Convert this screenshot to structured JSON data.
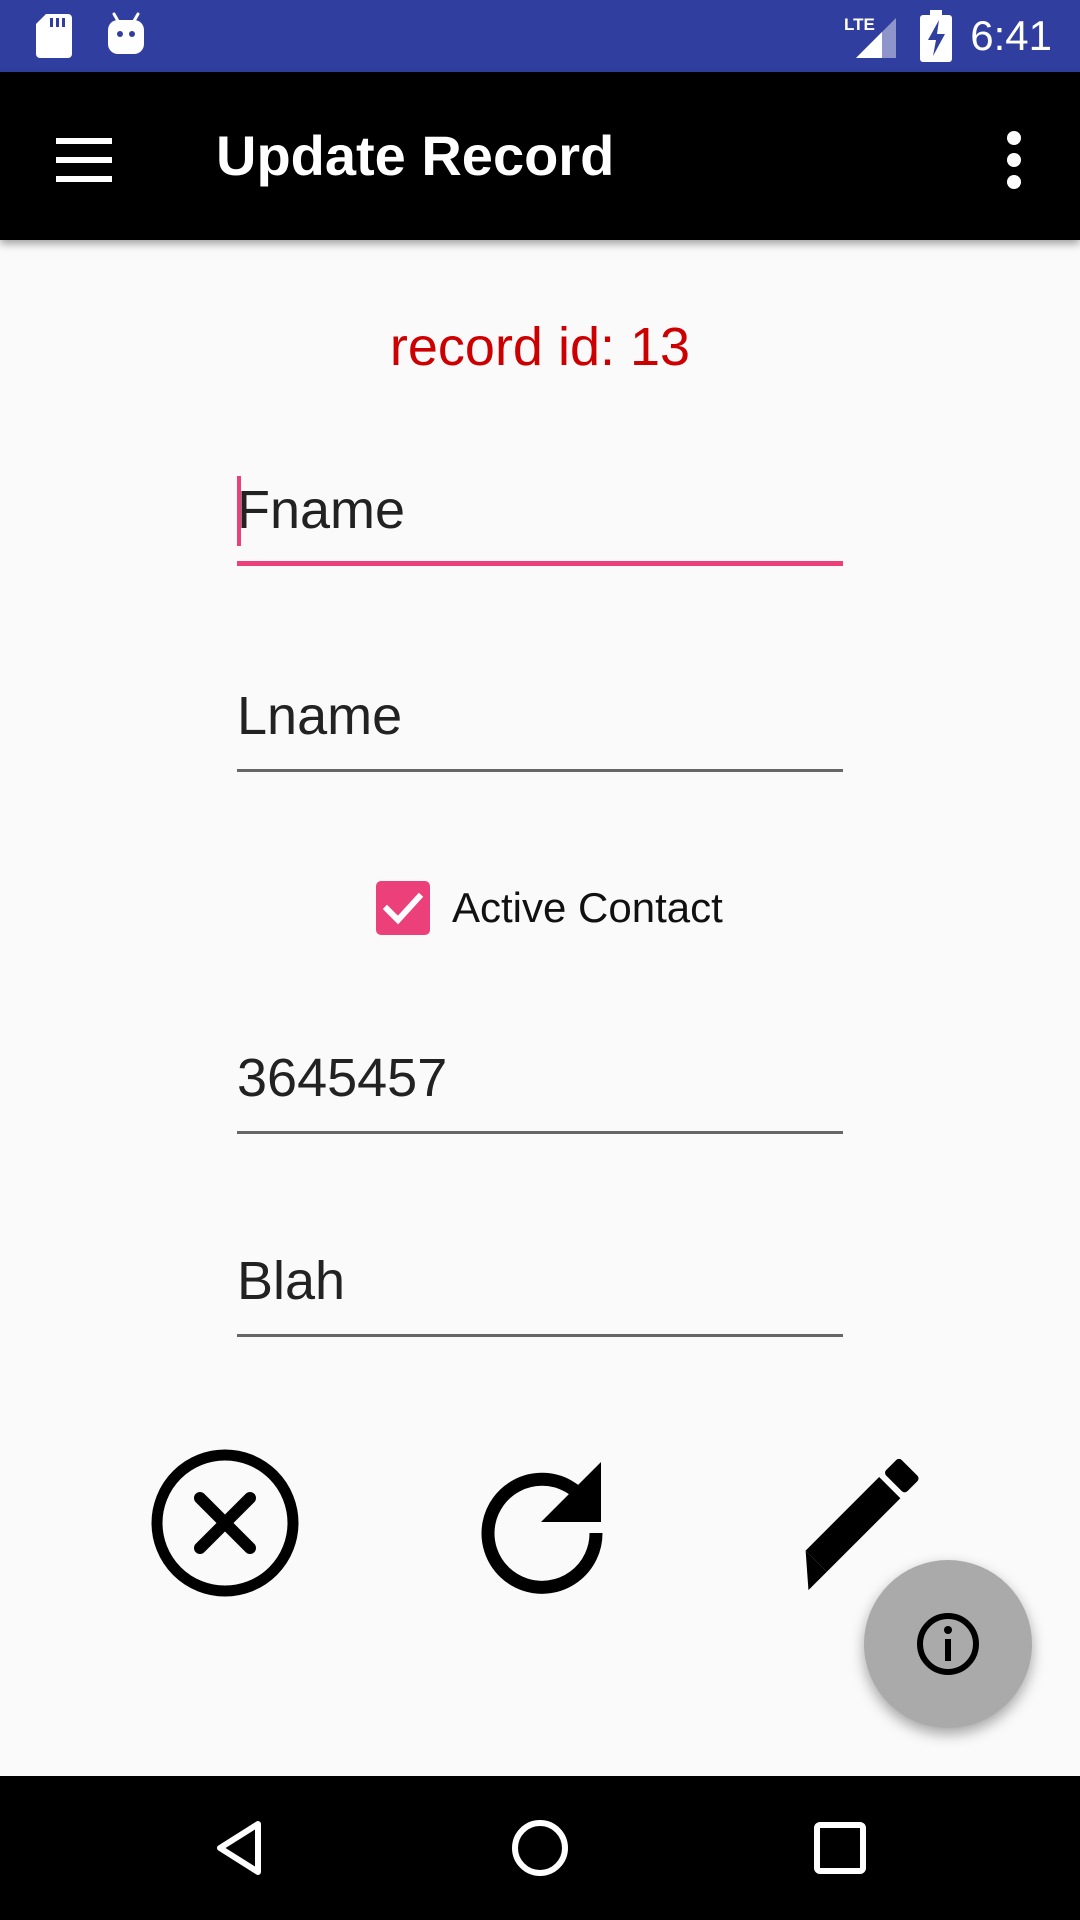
{
  "status_bar": {
    "time": "6:41",
    "network_label": "LTE",
    "icons": [
      "sd-card-icon",
      "android-debug-icon",
      "lte-signal-icon",
      "battery-charging-icon"
    ],
    "background_color": "#303f9f"
  },
  "app_bar": {
    "title": "Update Record",
    "icons": [
      "menu-icon",
      "more-vert-icon"
    ],
    "background_color": "#000000"
  },
  "form": {
    "record_id_text": "record id: 13",
    "record_id_color": "#cc0000",
    "first_name": "Fname",
    "last_name": "Lname",
    "active_contact_label": "Active Contact",
    "active_contact_checked": true,
    "phone": "3645457",
    "notes": "Blah",
    "accent_color": "#ec407a"
  },
  "actions": {
    "icons": [
      "cancel-icon",
      "refresh-icon",
      "edit-icon"
    ]
  },
  "fab": {
    "icon": "info-icon",
    "color": "#aaaaaa"
  },
  "nav_bar": {
    "icons": [
      "back-icon",
      "home-icon",
      "recents-icon"
    ]
  }
}
